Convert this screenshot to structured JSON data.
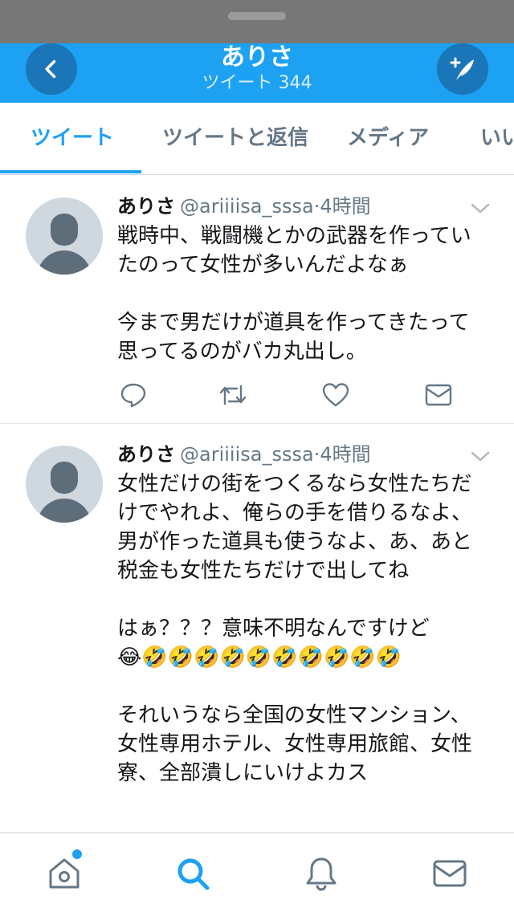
{
  "header": {
    "title": "ありさ",
    "subtitle": "ツイート 344"
  },
  "tabs": [
    {
      "label": "ツイート",
      "active": true
    },
    {
      "label": "ツイートと返信",
      "active": false
    },
    {
      "label": "メディア",
      "active": false
    },
    {
      "label": "いい",
      "active": false
    }
  ],
  "tweets": [
    {
      "name": "ありさ",
      "handle": "@ariiiisa_sssa",
      "separator": "·",
      "time": "4時間",
      "text": "戦時中、戦闘機とかの武器を作っていたのって女性が多いんだよなぁ\n\n今まで男だけが道具を作ってきたって思ってるのがバカ丸出し。"
    },
    {
      "name": "ありさ",
      "handle": "@ariiiisa_sssa",
      "separator": "·",
      "time": "4時間",
      "text": "女性だけの街をつくるなら女性たちだけでやれよ、俺らの手を借りるなよ、男が作った道具も使うなよ、あ、あと税金も女性たちだけで出してね\n\nはぁ？？？意味不明なんですけど\n😂🤣🤣🤣🤣🤣🤣🤣🤣🤣🤣\n\nそれいうなら全国の女性マンション、女性専用ホテル、女性専用旅館、女性寮、全部潰しにいけよカス"
    }
  ],
  "icons": {
    "back": "chevron-left-icon",
    "compose": "compose-feather-icon",
    "reply": "reply-icon",
    "retweet": "retweet-icon",
    "like": "heart-icon",
    "dm": "envelope-icon",
    "home": "home-icon",
    "search": "search-icon",
    "notifications": "bell-icon",
    "messages": "mail-icon"
  },
  "colors": {
    "brand": "#1da1f2",
    "text": "#14171a",
    "muted": "#657786"
  }
}
